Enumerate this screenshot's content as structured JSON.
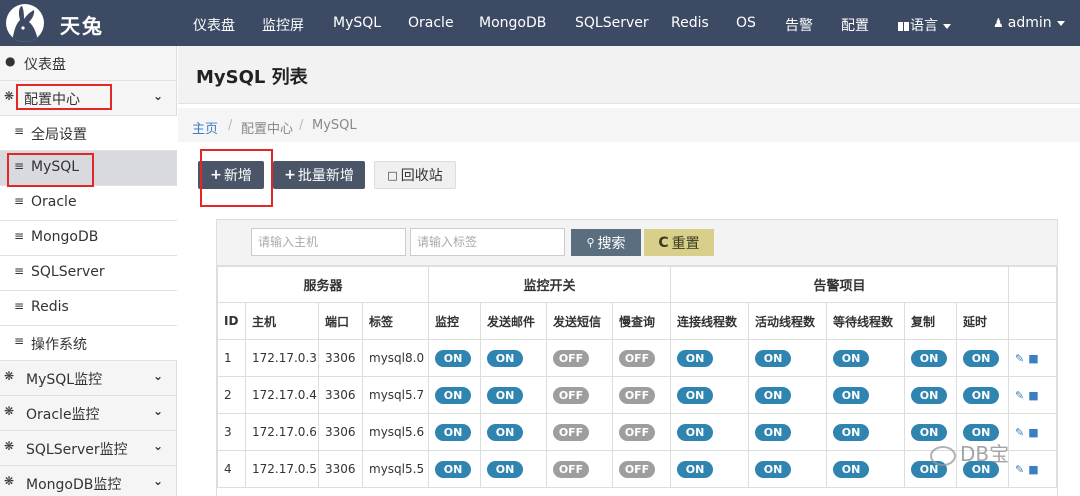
{
  "brand": {
    "name": "天兔"
  },
  "nav": {
    "items": [
      "仪表盘",
      "监控屏",
      "MySQL",
      "Oracle",
      "MongoDB",
      "SQLServer",
      "Redis",
      "OS",
      "告警",
      "配置"
    ],
    "language": "语言",
    "user": "admin"
  },
  "sidebar": {
    "items": [
      {
        "label": "仪表盘",
        "icon": "comment-icon"
      },
      {
        "label": "配置中心",
        "icon": "dashboard-icon",
        "expandable": true
      },
      {
        "label": "全局设置",
        "icon": "list-icon"
      },
      {
        "label": "MySQL",
        "icon": "list-icon",
        "active": true
      },
      {
        "label": "Oracle",
        "icon": "list-icon"
      },
      {
        "label": "MongoDB",
        "icon": "list-icon"
      },
      {
        "label": "SQLServer",
        "icon": "list-icon"
      },
      {
        "label": "Redis",
        "icon": "list-icon"
      },
      {
        "label": "操作系统",
        "icon": "list-icon"
      },
      {
        "label": "MySQL监控",
        "icon": "dashboard-icon",
        "expandable": true
      },
      {
        "label": "Oracle监控",
        "icon": "dashboard-icon",
        "expandable": true
      },
      {
        "label": "SQLServer监控",
        "icon": "dashboard-icon",
        "expandable": true
      },
      {
        "label": "MongoDB监控",
        "icon": "dashboard-icon",
        "expandable": true
      }
    ]
  },
  "page": {
    "title": "MySQL 列表",
    "breadcrumb": {
      "home": "主页",
      "section": "配置中心",
      "current": "MySQL",
      "sep": "/"
    }
  },
  "toolbar": {
    "add_label": "新增",
    "batch_add_label": "批量新增",
    "recycle_label": "回收站"
  },
  "filter": {
    "host_placeholder": "请输入主机",
    "tag_placeholder": "请输入标签",
    "search_label": "搜索",
    "reset_label": "重置"
  },
  "table": {
    "groups": [
      "服务器",
      "监控开关",
      "告警项目"
    ],
    "columns": [
      "ID",
      "主机",
      "端口",
      "标签",
      "监控",
      "发送邮件",
      "发送短信",
      "慢查询",
      "连接线程数",
      "活动线程数",
      "等待线程数",
      "复制",
      "延时"
    ],
    "rows": [
      {
        "id": "1",
        "host": "172.17.0.3",
        "port": "3306",
        "tag": "mysql8.0",
        "toggles": [
          "ON",
          "ON",
          "OFF",
          "OFF",
          "ON",
          "ON",
          "ON",
          "ON",
          "ON"
        ]
      },
      {
        "id": "2",
        "host": "172.17.0.4",
        "port": "3306",
        "tag": "mysql5.7",
        "toggles": [
          "ON",
          "ON",
          "OFF",
          "OFF",
          "ON",
          "ON",
          "ON",
          "ON",
          "ON"
        ]
      },
      {
        "id": "3",
        "host": "172.17.0.6",
        "port": "3306",
        "tag": "mysql5.6",
        "toggles": [
          "ON",
          "ON",
          "OFF",
          "OFF",
          "ON",
          "ON",
          "ON",
          "ON",
          "ON"
        ]
      },
      {
        "id": "4",
        "host": "172.17.0.5",
        "port": "3306",
        "tag": "mysql5.5",
        "toggles": [
          "ON",
          "ON",
          "OFF",
          "OFF",
          "ON",
          "ON",
          "ON",
          "ON",
          "ON"
        ]
      }
    ]
  },
  "watermark": {
    "text": "DB宝"
  },
  "colors": {
    "navbar": "#3c4a63",
    "toggle_on": "#2f84b0",
    "toggle_off": "#9e9e9e",
    "highlight": "#e32626"
  }
}
